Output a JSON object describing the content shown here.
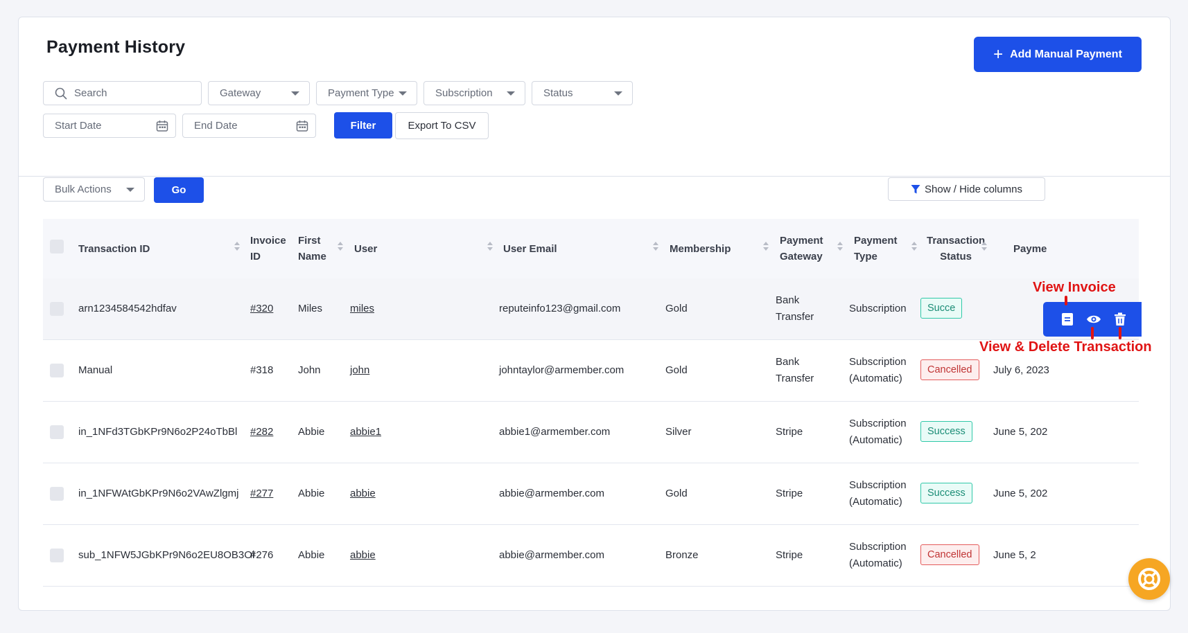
{
  "page": {
    "title": "Payment History",
    "add_button_label": "Add Manual Payment"
  },
  "filters": {
    "search_placeholder": "Search",
    "gateway": "Gateway",
    "payment_type": "Payment Type",
    "subscription": "Subscription",
    "status": "Status",
    "start_date_placeholder": "Start Date",
    "end_date_placeholder": "End Date",
    "filter_label": "Filter",
    "export_label": "Export To CSV"
  },
  "toolbar": {
    "bulk_actions": "Bulk Actions",
    "go_label": "Go",
    "show_hide_label": "Show / Hide columns"
  },
  "table": {
    "headers": {
      "transaction_id": "Transaction ID",
      "invoice_id_1": "Invoice",
      "invoice_id_2": "ID",
      "first_name_1": "First",
      "first_name_2": "Name",
      "user": "User",
      "user_email": "User Email",
      "membership": "Membership",
      "gateway_1": "Payment",
      "gateway_2": "Gateway",
      "type_1": "Payment",
      "type_2": "Type",
      "status_1": "Transaction",
      "status_2": "Status",
      "date": "Payme"
    },
    "rows": [
      {
        "txn": "arn1234584542hdfav",
        "invoice": "#320",
        "invoice_link": true,
        "first": "Miles",
        "user": "miles",
        "email": "reputeinfo123@gmail.com",
        "membership": "Gold",
        "gw1": "Bank",
        "gw2": "Transfer",
        "type1": "Subscription",
        "type2": "",
        "status": "Succe",
        "status_kind": "success",
        "date": ""
      },
      {
        "txn": "Manual",
        "invoice": "#318",
        "invoice_link": false,
        "first": "John",
        "user": "john",
        "email": "johntaylor@armember.com",
        "membership": "Gold",
        "gw1": "Bank",
        "gw2": "Transfer",
        "type1": "Subscription",
        "type2": "(Automatic)",
        "status": "Cancelled",
        "status_kind": "cancelled",
        "date": "July 6, 2023"
      },
      {
        "txn": "in_1NFd3TGbKPr9N6o2P24oTbBl",
        "invoice": "#282",
        "invoice_link": true,
        "first": "Abbie",
        "user": "abbie1",
        "email": "abbie1@armember.com",
        "membership": "Silver",
        "gw1": "Stripe",
        "gw2": "",
        "type1": "Subscription",
        "type2": "(Automatic)",
        "status": "Success",
        "status_kind": "success",
        "date": "June 5, 202"
      },
      {
        "txn": "in_1NFWAtGbKPr9N6o2VAwZlgmj",
        "invoice": "#277",
        "invoice_link": true,
        "first": "Abbie",
        "user": "abbie",
        "email": "abbie@armember.com",
        "membership": "Gold",
        "gw1": "Stripe",
        "gw2": "",
        "type1": "Subscription",
        "type2": "(Automatic)",
        "status": "Success",
        "status_kind": "success",
        "date": "June 5, 202"
      },
      {
        "txn": "sub_1NFW5JGbKPr9N6o2EU8OB3Ol",
        "invoice": "#276",
        "invoice_link": false,
        "first": "Abbie",
        "user": "abbie",
        "email": "abbie@armember.com",
        "membership": "Bronze",
        "gw1": "Stripe",
        "gw2": "",
        "type1": "Subscription",
        "type2": "(Automatic)",
        "status": "Cancelled",
        "status_kind": "cancelled",
        "date": "June 5, 2"
      }
    ]
  },
  "annotations": {
    "view_invoice": "View Invoice",
    "view_delete": "View & Delete Transaction"
  },
  "icons": {
    "row_actions": [
      "invoice-icon",
      "eye-icon",
      "trash-icon"
    ],
    "help": "lifebuoy-icon"
  },
  "colors": {
    "primary": "#1d50e8",
    "success": "#2fc8a8",
    "cancelled": "#e45b5b",
    "annotation": "#e01414",
    "help_fab": "#f6a623"
  }
}
